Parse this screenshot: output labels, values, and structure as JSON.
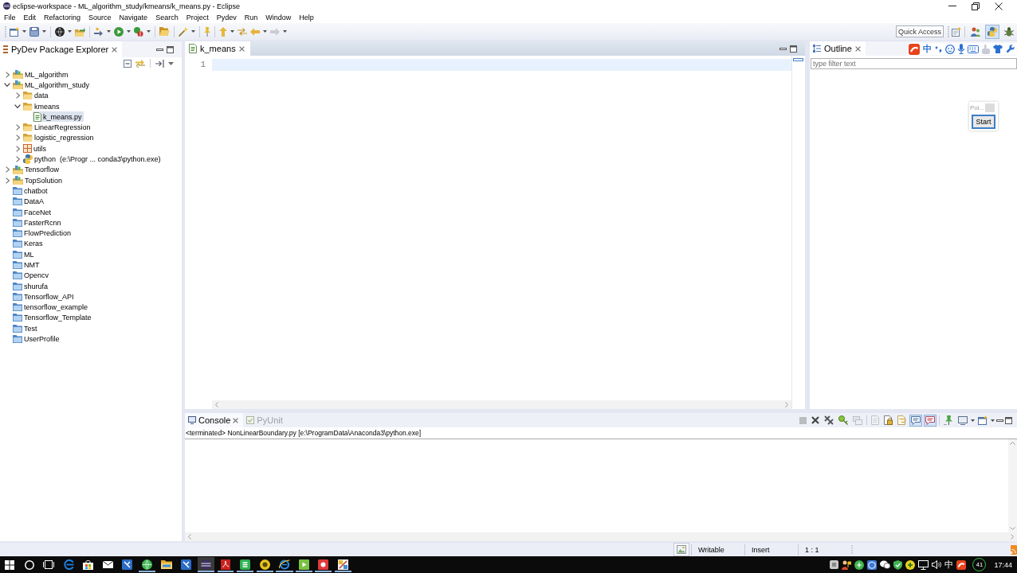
{
  "window": {
    "title": "eclipse-workspace - ML_algorithm_study/kmeans/k_means.py - Eclipse"
  },
  "menu": [
    "File",
    "Edit",
    "Refactoring",
    "Source",
    "Navigate",
    "Search",
    "Project",
    "Pydev",
    "Run",
    "Window",
    "Help"
  ],
  "toolbar": {
    "quick_access": {
      "placeholder": "Quick Access"
    },
    "perspectives": [
      {
        "kind": "java",
        "selected": false
      },
      {
        "kind": "python",
        "selected": true
      },
      {
        "kind": "debug",
        "selected": false
      }
    ]
  },
  "package_explorer": {
    "title": "PyDev Package Explorer",
    "tree": [
      {
        "label": "ML_algorithm",
        "kind": "project",
        "expanded": false,
        "selected": false
      },
      {
        "label": "ML_algorithm_study",
        "kind": "project",
        "expanded": true,
        "selected": false,
        "children": [
          {
            "label": "data",
            "kind": "folder",
            "expanded": false,
            "selected": false
          },
          {
            "label": "kmeans",
            "kind": "folder",
            "expanded": true,
            "selected": false,
            "children": [
              {
                "label": "k_means.py",
                "kind": "file",
                "selected": true
              }
            ]
          },
          {
            "label": "LinearRegression",
            "kind": "folder",
            "expanded": false,
            "selected": false
          },
          {
            "label": "logistic_regression",
            "kind": "folder",
            "expanded": false,
            "selected": false
          },
          {
            "label": "utils",
            "kind": "package",
            "expanded": false,
            "selected": false
          },
          {
            "label": "python  (e:\\Progr ... conda3\\python.exe)",
            "kind": "interpreter",
            "expanded": false,
            "selected": false
          }
        ]
      },
      {
        "label": "Tensorflow",
        "kind": "project",
        "expanded": false,
        "selected": false
      },
      {
        "label": "TopSolution",
        "kind": "project",
        "expanded": false,
        "selected": false
      },
      {
        "label": "chatbot",
        "kind": "closed_project",
        "selected": false
      },
      {
        "label": "DataA",
        "kind": "closed_project",
        "selected": false
      },
      {
        "label": "FaceNet",
        "kind": "closed_project",
        "selected": false
      },
      {
        "label": "FasterRcnn",
        "kind": "closed_project",
        "selected": false
      },
      {
        "label": "FlowPrediction",
        "kind": "closed_project",
        "selected": false
      },
      {
        "label": "Keras",
        "kind": "closed_project",
        "selected": false
      },
      {
        "label": "ML",
        "kind": "closed_project",
        "selected": false
      },
      {
        "label": "NMT",
        "kind": "closed_project",
        "selected": false
      },
      {
        "label": "Opencv",
        "kind": "closed_project",
        "selected": false
      },
      {
        "label": "shurufa",
        "kind": "closed_project",
        "selected": false
      },
      {
        "label": "Tensorflow_API",
        "kind": "closed_project",
        "selected": false
      },
      {
        "label": "tensorflow_example",
        "kind": "closed_project",
        "selected": false
      },
      {
        "label": "Tensorflow_Template",
        "kind": "closed_project",
        "selected": false
      },
      {
        "label": "Test",
        "kind": "closed_project",
        "selected": false
      },
      {
        "label": "UserProfile",
        "kind": "closed_project",
        "selected": false
      }
    ]
  },
  "editor": {
    "tabs": [
      {
        "label": "k_means",
        "selected": true
      }
    ],
    "line_numbers": [
      "1"
    ]
  },
  "outline": {
    "title": "Outline",
    "filter": {
      "placeholder": "type filter text"
    }
  },
  "ime_toolbar": {
    "mode": "中"
  },
  "popup": {
    "title": "Poi...",
    "button": "Start"
  },
  "console": {
    "tabs": [
      {
        "label": "Console",
        "kind": "console",
        "selected": true
      },
      {
        "label": "PyUnit",
        "kind": "pyunit",
        "selected": false
      }
    ],
    "toolbar": [
      {
        "kind": "terminate",
        "disabled": true,
        "on": false
      },
      {
        "kind": "remove",
        "disabled": false,
        "on": false
      },
      {
        "kind": "remove_all",
        "disabled": false,
        "on": false
      },
      {
        "kind": "key",
        "disabled": false,
        "on": false
      },
      {
        "kind": "windows",
        "disabled": true,
        "on": false
      },
      {
        "kind": "clear",
        "disabled": true,
        "on": false
      },
      {
        "kind": "scroll_lock",
        "disabled": false,
        "on": false
      },
      {
        "kind": "word_wrap",
        "disabled": false,
        "on": false
      },
      {
        "kind": "stdout",
        "disabled": false,
        "on": true
      },
      {
        "kind": "stderr",
        "disabled": false,
        "on": true
      },
      {
        "kind": "pin",
        "disabled": false,
        "on": false
      },
      {
        "kind": "display",
        "disabled": false,
        "on": false
      },
      {
        "kind": "new_console",
        "disabled": false,
        "on": false
      }
    ],
    "process": "<terminated> NonLinearBoundary.py [e:\\ProgramData\\Anaconda3\\python.exe]"
  },
  "status_bar": {
    "fields": [
      "Writable",
      "Insert",
      "1 : 1"
    ]
  },
  "taskbar": {
    "apps": [
      {
        "kind": "edge",
        "running": false,
        "selected": false
      },
      {
        "kind": "store",
        "running": false,
        "selected": false
      },
      {
        "kind": "mail",
        "running": false,
        "selected": false
      },
      {
        "kind": "tool",
        "running": false,
        "selected": false
      },
      {
        "kind": "globe",
        "running": true,
        "selected": false
      },
      {
        "kind": "folder",
        "running": false,
        "selected": false
      },
      {
        "kind": "tool",
        "running": false,
        "selected": false
      },
      {
        "kind": "eclipse",
        "running": true,
        "selected": true
      },
      {
        "kind": "pdf",
        "running": true,
        "selected": false
      },
      {
        "kind": "sheet",
        "running": true,
        "selected": false
      },
      {
        "kind": "coin",
        "running": true,
        "selected": false
      },
      {
        "kind": "ie",
        "running": true,
        "selected": false
      },
      {
        "kind": "green_c",
        "running": true,
        "selected": false
      },
      {
        "kind": "red_c",
        "running": true,
        "selected": false
      },
      {
        "kind": "paint",
        "running": true,
        "selected": false
      }
    ],
    "input_method": "中",
    "badge": "41",
    "clock": "17:44"
  }
}
